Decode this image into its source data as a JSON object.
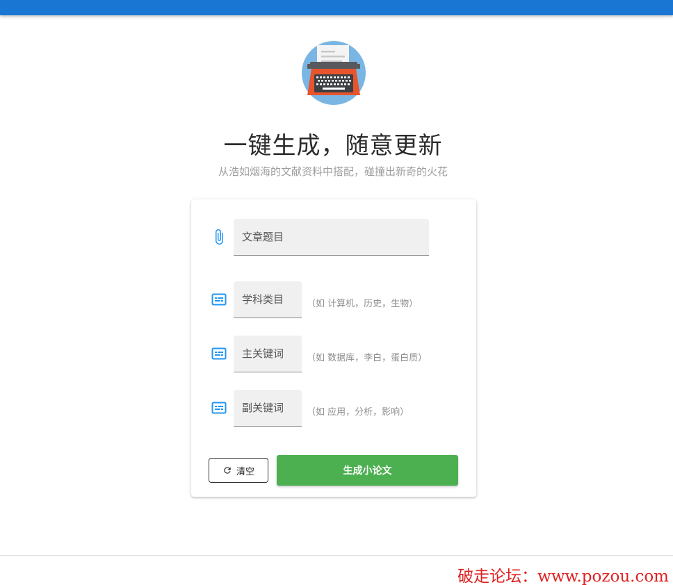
{
  "header": {
    "color": "#1976d2"
  },
  "logo": {
    "icon": "typewriter-icon"
  },
  "hero": {
    "title": "一键生成，随意更新",
    "subtitle": "从浩如烟海的文献资料中搭配，碰撞出新奇的火花"
  },
  "form": {
    "fields": [
      {
        "icon": "paperclip-icon",
        "placeholder": "文章题目",
        "value": "",
        "hint": ""
      },
      {
        "icon": "subtitles-icon",
        "placeholder": "学科类目",
        "value": "",
        "hint": "（如 计算机，历史，生物）"
      },
      {
        "icon": "subtitles-icon",
        "placeholder": "主关键词",
        "value": "",
        "hint": "（如 数据库，李白，蛋白质）"
      },
      {
        "icon": "subtitles-icon",
        "placeholder": "副关键词",
        "value": "",
        "hint": "（如 应用，分析，影响）"
      }
    ],
    "clear_label": "清空",
    "submit_label": "生成小论文"
  },
  "watermark": "破走论坛：www.pozou.com",
  "colors": {
    "accent": "#2196f3",
    "submit": "#4caf50",
    "watermark": "#e02020"
  }
}
